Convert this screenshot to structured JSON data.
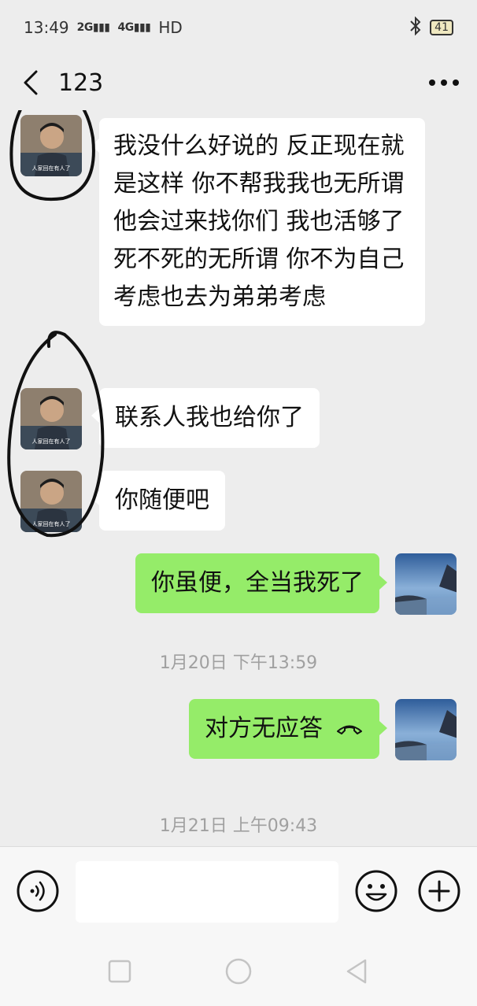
{
  "status_bar": {
    "time": "13:49",
    "signal1": "2G",
    "signal2": "4G",
    "hd": "HD",
    "battery": "41"
  },
  "header": {
    "title": "123",
    "back_icon": "back-chevron-icon",
    "more_icon": "more-dots-icon"
  },
  "messages": [
    {
      "side": "left",
      "text": "我没什么好说的 反正现在就是这样 你不帮我我也无所谓 他会过来找你们 我也活够了 死不死的无所谓 你不为自己考虑也去为弟弟考虑"
    },
    {
      "side": "left",
      "text": "联系人我也给你了"
    },
    {
      "side": "left",
      "text": "你随便吧"
    },
    {
      "side": "right",
      "text": "你虽便，全当我死了"
    },
    {
      "side": "right",
      "text": "对方无应答",
      "icon": "hangup-phone-icon"
    }
  ],
  "time_separators": [
    "1月20日 下午13:59",
    "1月21日 上午09:43"
  ],
  "avatar_caption": "人家回在有人了",
  "input_bar": {
    "voice_icon": "voice-icon",
    "emoji_icon": "emoji-icon",
    "plus_icon": "plus-icon",
    "input_value": ""
  },
  "nav_bar": {
    "icons": [
      "recent-apps-icon",
      "home-icon",
      "back-triangle-icon"
    ]
  },
  "colors": {
    "background": "#ededed",
    "sent_bubble": "#95ec69",
    "received_bubble": "#ffffff",
    "timestamp": "#a0a0a0"
  }
}
